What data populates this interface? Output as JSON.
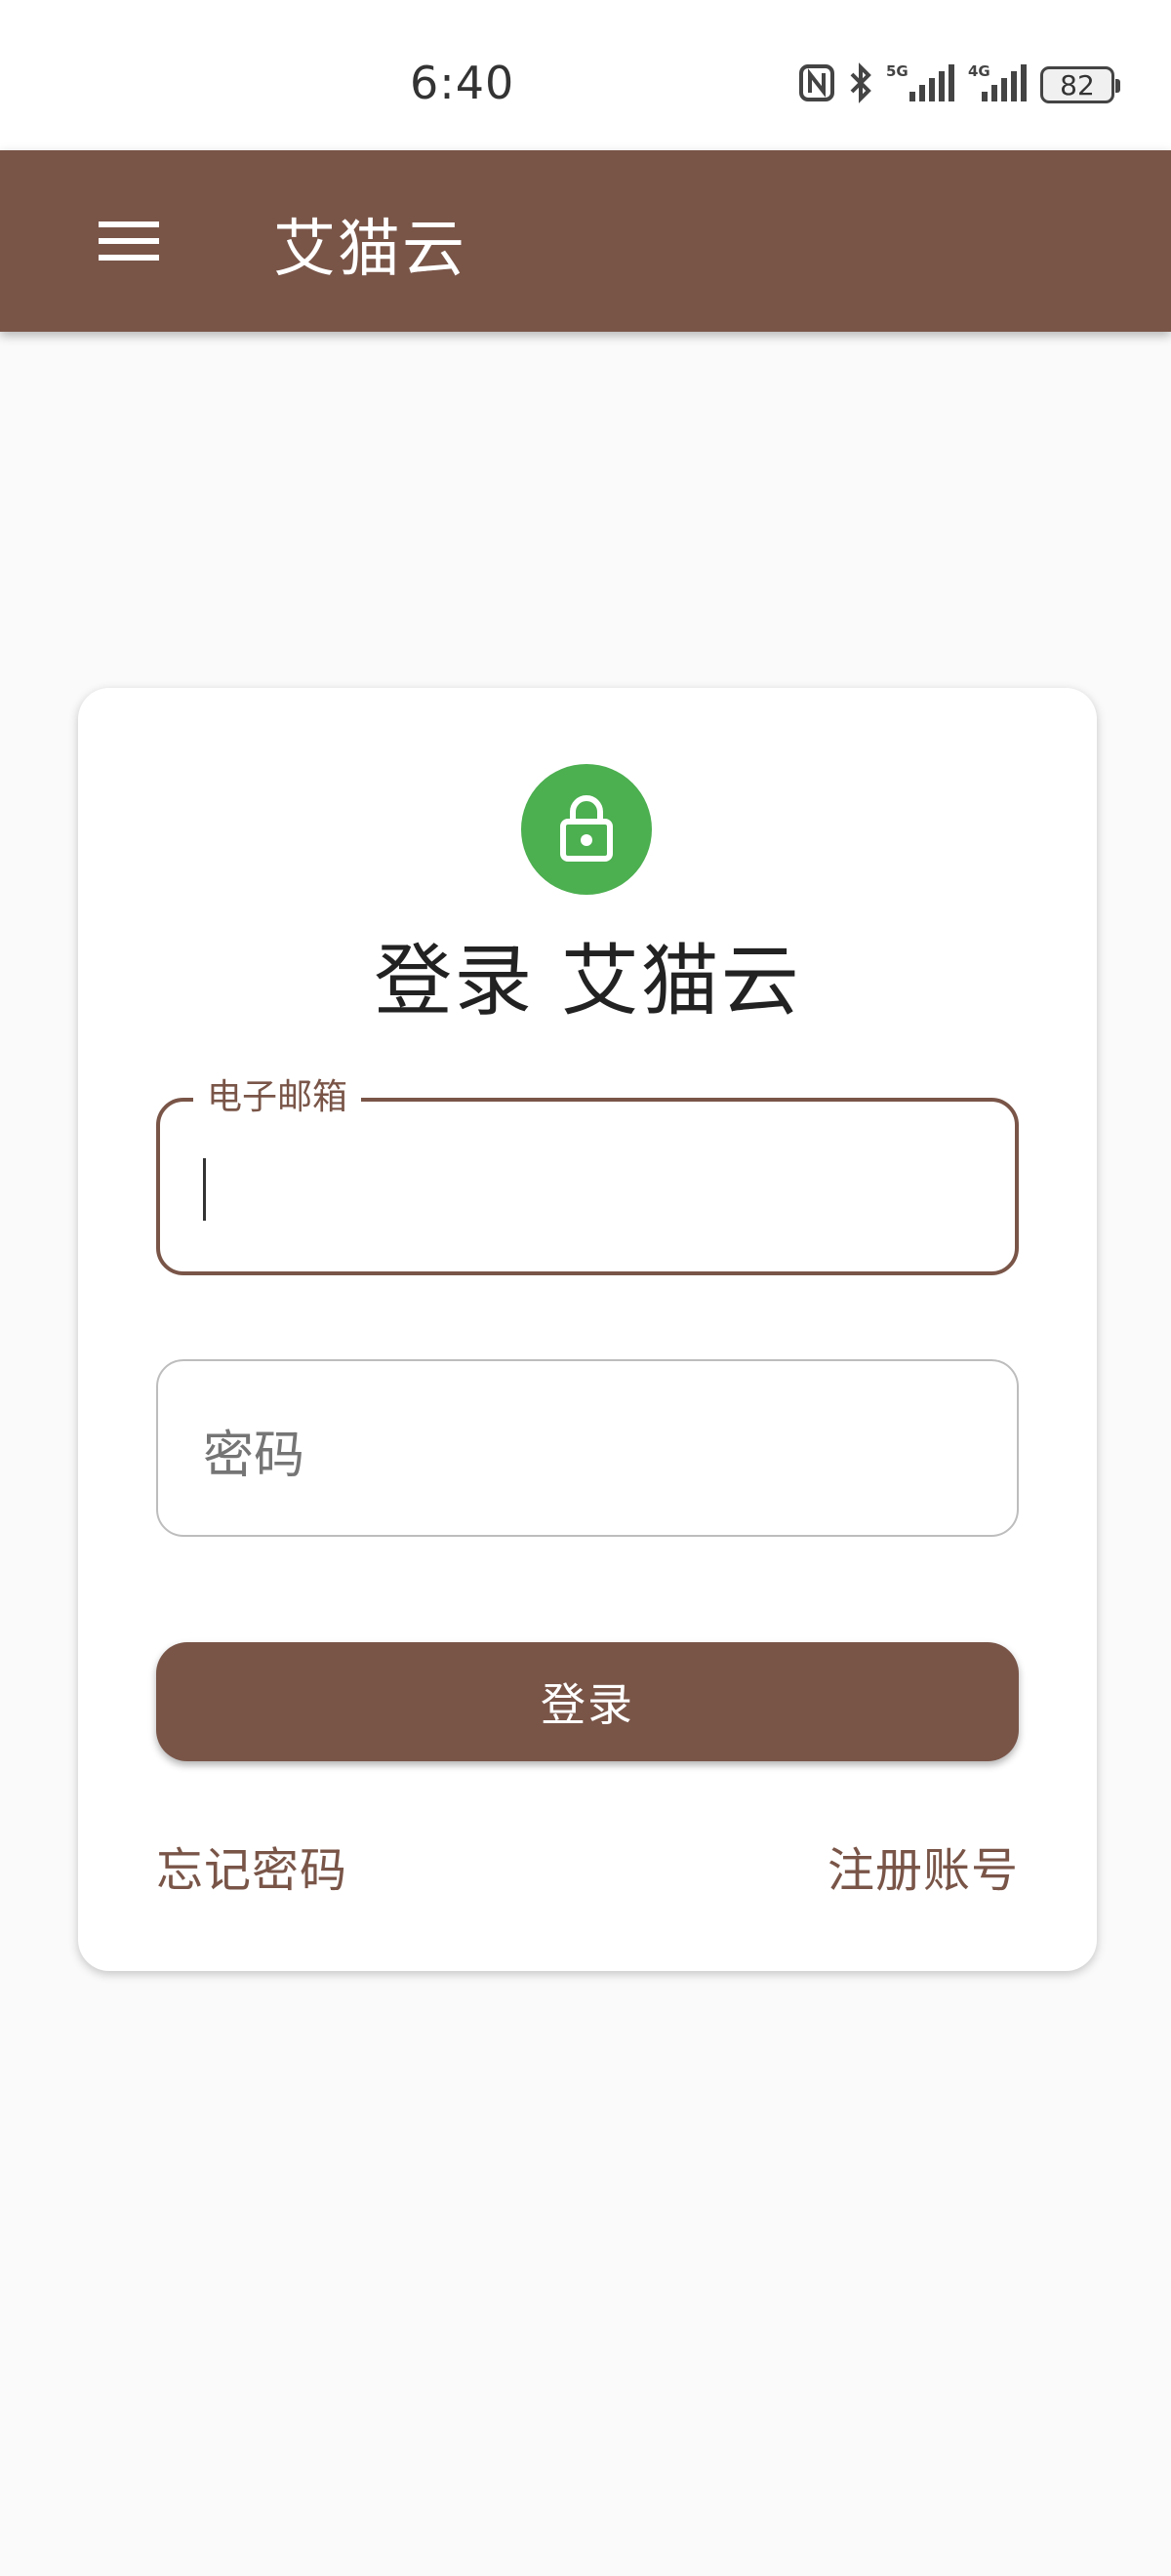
{
  "status_bar": {
    "time": "6:40",
    "battery": "82",
    "icons": [
      "nfc-icon",
      "bluetooth-icon",
      "5g-signal-icon",
      "4g-signal-icon",
      "battery-icon"
    ]
  },
  "app_bar": {
    "title": "艾猫云",
    "menu_icon": "hamburger-menu-icon",
    "background": "#795548"
  },
  "login_card": {
    "lock_icon": "lock-icon",
    "lock_color": "#4caf50",
    "title": "登录 艾猫云",
    "email_field": {
      "label": "电子邮箱",
      "value": ""
    },
    "password_field": {
      "placeholder": "密码",
      "value": ""
    },
    "login_button": "登录",
    "forgot_password_link": "忘记密码",
    "register_link": "注册账号"
  },
  "colors": {
    "primary": "#795548",
    "accent": "#4caf50",
    "background": "#fafafa"
  }
}
